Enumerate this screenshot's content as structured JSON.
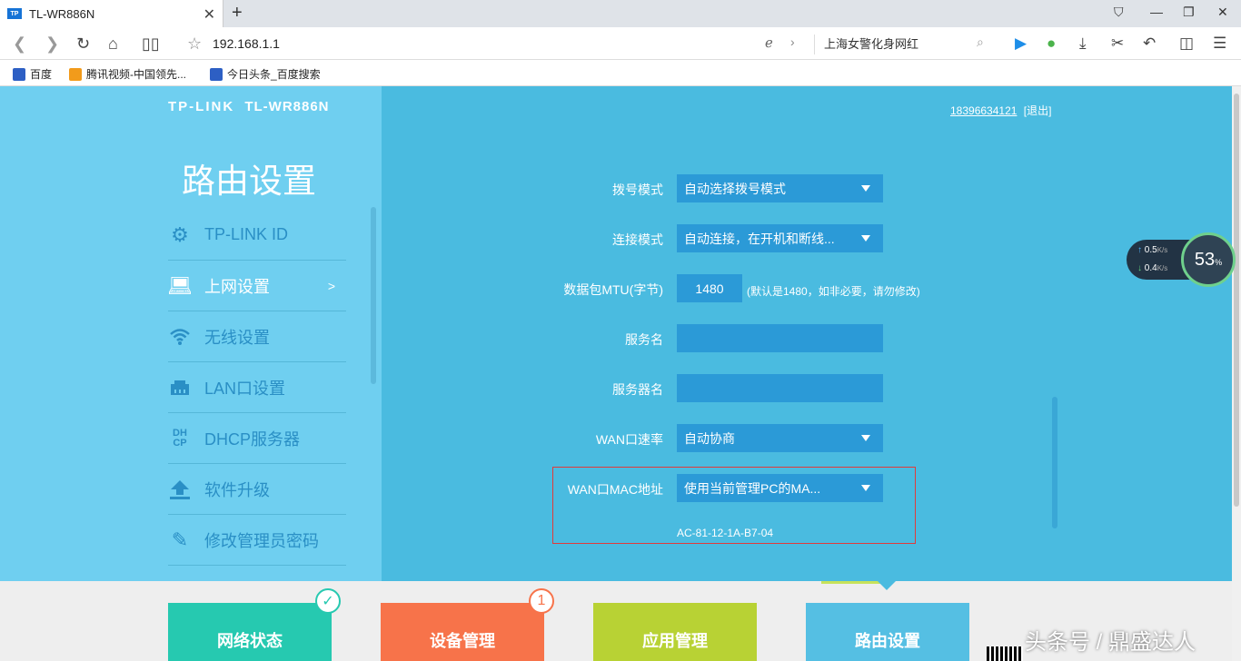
{
  "browser": {
    "tab_title": "TL-WR886N",
    "tab_logo": "TP",
    "url": "192.168.1.1",
    "search_text": "上海女警化身网红",
    "icons": [
      "back-icon",
      "forward-icon",
      "reload-icon",
      "home-icon",
      "reader-icon",
      "star-icon",
      "ie-icon",
      "search-icon",
      "play-icon",
      "wechat-icon",
      "download-icon",
      "scissors-icon",
      "undo-icon",
      "bag-icon",
      "menu-icon"
    ]
  },
  "bookmarks": [
    {
      "label": "百度",
      "color": "#2d5fc4"
    },
    {
      "label": "腾讯视频-中国领先...",
      "color": "#f29b1b"
    },
    {
      "label": "今日头条_百度搜索",
      "color": "#2d5fc4"
    }
  ],
  "header": {
    "logo": "TP-LINK",
    "model": "TL-WR886N",
    "phone": "18396634121",
    "logout": "[退出]"
  },
  "sidebar": {
    "title": "路由设置",
    "items": [
      {
        "label": "TP-LINK ID",
        "icon": "gear-icon"
      },
      {
        "label": "上网设置",
        "icon": "laptop-icon",
        "arrow": ">"
      },
      {
        "label": "无线设置",
        "icon": "wifi-icon"
      },
      {
        "label": "LAN口设置",
        "icon": "lan-icon"
      },
      {
        "label": "DHCP服务器",
        "icon": "dhcp-icon",
        "glyph": "DH\nCP"
      },
      {
        "label": "软件升级",
        "icon": "upload-icon"
      },
      {
        "label": "修改管理员密码",
        "icon": "pencil-icon"
      }
    ]
  },
  "form": {
    "dial_mode": {
      "label": "拨号模式",
      "value": "自动选择拨号模式"
    },
    "connect_mode": {
      "label": "连接模式",
      "value": "自动连接，在开机和断线..."
    },
    "mtu": {
      "label": "数据包MTU(字节)",
      "value": "1480",
      "hint": "(默认是1480，如非必要，请勿修改)"
    },
    "service_name": {
      "label": "服务名",
      "value": ""
    },
    "server_name": {
      "label": "服务器名",
      "value": ""
    },
    "wan_speed": {
      "label": "WAN口速率",
      "value": "自动协商"
    },
    "wan_mac": {
      "label": "WAN口MAC地址",
      "value": "使用当前管理PC的MA...",
      "mac": "AC-81-12-1A-B7-04"
    }
  },
  "footer": {
    "tiles": [
      {
        "label": "网络状态",
        "color": "#26c9b0",
        "badge": "✓"
      },
      {
        "label": "设备管理",
        "color": "#f7734a",
        "badge": "1"
      },
      {
        "label": "应用管理",
        "color": "#b8d234"
      },
      {
        "label": "路由设置",
        "color": "#55bfe3"
      }
    ]
  },
  "speed_widget": {
    "up": "0.5",
    "down": "0.4",
    "unit": "K/s",
    "percent": "53",
    "percent_sign": "%"
  },
  "watermark": "头条号 / 鼎盛达人"
}
